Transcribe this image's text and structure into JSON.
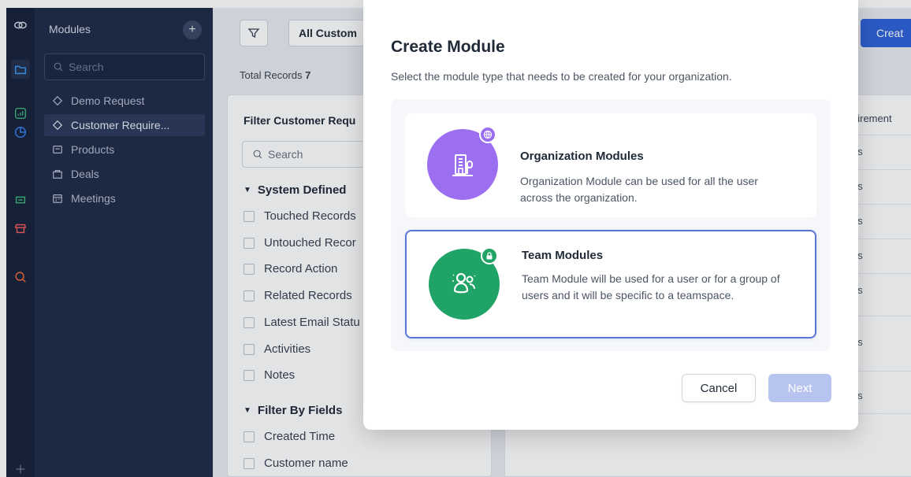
{
  "sidebar": {
    "title": "Modules",
    "add_icon": "plus-icon",
    "search_placeholder": "Search",
    "items": [
      {
        "label": "Demo Request",
        "icon": "module-diamond-icon"
      },
      {
        "label": "Customer Require...",
        "icon": "module-diamond-icon"
      },
      {
        "label": "Products",
        "icon": "products-icon"
      },
      {
        "label": "Deals",
        "icon": "deals-icon"
      },
      {
        "label": "Meetings",
        "icon": "calendar-icon"
      }
    ]
  },
  "rail": {
    "icons": [
      "app-logo-icon",
      "folder-icon",
      "analytics-icon",
      "pie-chart-icon",
      "refresh-icon",
      "store-icon",
      "search-icon"
    ]
  },
  "toolbar": {
    "view_label": "All Custom",
    "create_label": "Creat",
    "total_records_label": "Total Records",
    "total_records_value": "7"
  },
  "filter_panel": {
    "title": "Filter Customer Requ",
    "search_placeholder": "Search",
    "system_defined_label": "System Defined",
    "system_items": [
      "Touched Records",
      "Untouched Recor",
      "Record Action",
      "Related Records",
      "Latest Email Statu",
      "Activities",
      "Notes"
    ],
    "filter_by_fields_label": "Filter By Fields",
    "field_items": [
      "Created Time",
      "Customer name"
    ]
  },
  "table": {
    "column_header": "uirement",
    "row_fragments": [
      "ds",
      "ds",
      "ds",
      "ds",
      "ds",
      "ds",
      "ds"
    ]
  },
  "modal": {
    "title": "Create Module",
    "subtitle": "Select the module type that needs to be created for your organization.",
    "options": [
      {
        "title": "Organization Modules",
        "description": "Organization Module can be used for all the user across the organization.",
        "icon": "building-icon",
        "badge_icon": "globe-icon",
        "color": "#9b6ff0",
        "selected": false
      },
      {
        "title": "Team Modules",
        "description": "Team Module will be used for a user or for a group of users and it will be specific to a teamspace.",
        "icon": "team-users-icon",
        "badge_icon": "lock-icon",
        "color": "#1fa366",
        "selected": true
      }
    ],
    "cancel_label": "Cancel",
    "next_label": "Next"
  },
  "colors": {
    "accent": "#2f62d9",
    "selected_border": "#5b74d8",
    "sidebar_bg": "#1f2b46"
  }
}
